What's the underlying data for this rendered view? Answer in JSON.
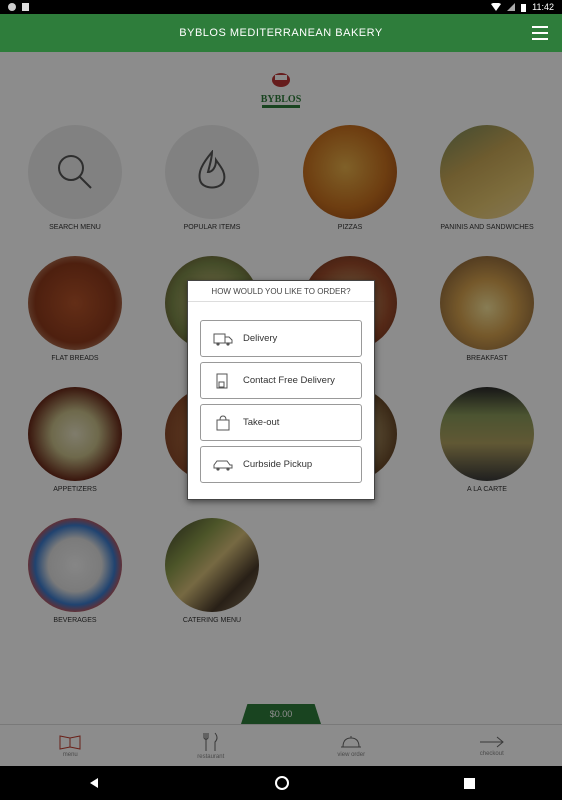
{
  "status_bar": {
    "time": "11:42"
  },
  "header": {
    "title": "BYBLOS MEDITERRANEAN BAKERY"
  },
  "logo": {
    "text": "BYBLOS"
  },
  "categories": [
    {
      "label": "SEARCH MENU"
    },
    {
      "label": "POPULAR ITEMS"
    },
    {
      "label": "PIZZAS"
    },
    {
      "label": "PANINIS AND SANDWICHES"
    },
    {
      "label": "FLAT BREADS"
    },
    {
      "label": ""
    },
    {
      "label": ""
    },
    {
      "label": "BREAKFAST"
    },
    {
      "label": "APPETIZERS"
    },
    {
      "label": ""
    },
    {
      "label": ""
    },
    {
      "label": "A LA CARTE"
    },
    {
      "label": "BEVERAGES"
    },
    {
      "label": "CATERING MENU"
    }
  ],
  "dialog": {
    "title": "HOW WOULD YOU LIKE TO ORDER?",
    "options": [
      "Delivery",
      "Contact Free Delivery",
      "Take-out",
      "Curbside Pickup"
    ]
  },
  "cart": {
    "total": "$0.00"
  },
  "bottom_nav": {
    "menu": "menu",
    "restaurant": "restaurant",
    "view_order": "view order",
    "checkout": "checkout"
  },
  "colors": {
    "brand_green": "#2e7d3b"
  }
}
